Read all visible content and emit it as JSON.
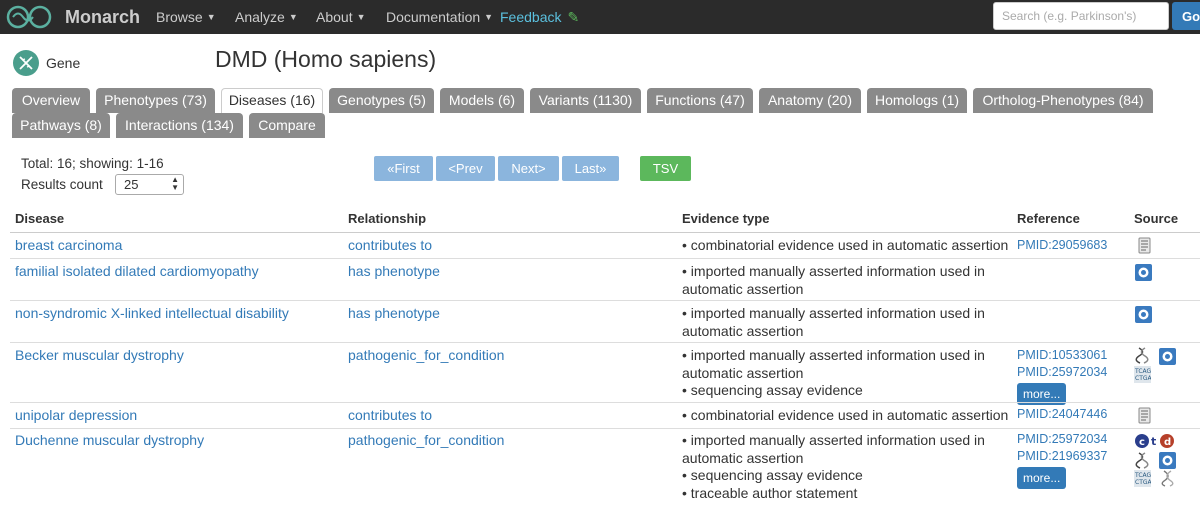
{
  "nav": {
    "brand": "Monarch",
    "items": [
      "Browse",
      "Analyze",
      "About",
      "Documentation"
    ],
    "feedback": "Feedback",
    "search_placeholder": "Search (e.g. Parkinson's)",
    "go": "Go"
  },
  "header": {
    "category": "Gene",
    "title": "DMD  (Homo sapiens)"
  },
  "tabs": [
    "Overview",
    "Phenotypes (73)",
    "Diseases (16)",
    "Genotypes (5)",
    "Models (6)",
    "Variants (1130)",
    "Functions (47)",
    "Anatomy (20)",
    "Homologs (1)",
    "Ortholog-Phenotypes (84)",
    "Pathways (8)",
    "Interactions (134)",
    "Compare"
  ],
  "active_tab": "Diseases (16)",
  "controls": {
    "total": "Total: 16; showing: 1-16",
    "results_count_label": "Results count",
    "results_count_value": "25",
    "pager": [
      "«First",
      "<Prev",
      "Next>",
      "Last»"
    ],
    "tsv": "TSV"
  },
  "table": {
    "headers": [
      "Disease",
      "Relationship",
      "Evidence type",
      "Reference",
      "Source"
    ],
    "more_label": "more...",
    "rows": [
      {
        "disease": "breast carcinoma",
        "relationship": "contributes to",
        "evidence": [
          "• combinatorial evidence used in automatic assertion"
        ],
        "references": [
          "PMID:29059683"
        ],
        "more": false,
        "sources": [
          "document-source-icon"
        ]
      },
      {
        "disease": "familial isolated dilated cardiomyopathy",
        "relationship": "has phenotype",
        "evidence": [
          "• imported manually asserted information used in automatic assertion"
        ],
        "references": [],
        "more": false,
        "sources": [
          "orphanet-source-icon"
        ]
      },
      {
        "disease": "non-syndromic X-linked intellectual disability",
        "relationship": "has phenotype",
        "evidence": [
          "• imported manually asserted information used in automatic assertion"
        ],
        "references": [],
        "more": false,
        "sources": [
          "orphanet-source-icon"
        ]
      },
      {
        "disease": "Becker muscular dystrophy",
        "relationship": "pathogenic_for_condition",
        "evidence": [
          "• imported manually asserted information used in automatic assertion",
          "• sequencing assay evidence"
        ],
        "references": [
          "PMID:10533061",
          "PMID:25972034"
        ],
        "more": true,
        "sources": [
          "clinvar-source-icon",
          "orphanet-source-icon",
          "tcag-source-icon"
        ]
      },
      {
        "disease": "unipolar depression",
        "relationship": "contributes to",
        "evidence": [
          "• combinatorial evidence used in automatic assertion"
        ],
        "references": [
          "PMID:24047446"
        ],
        "more": false,
        "sources": [
          "document-source-icon"
        ]
      },
      {
        "disease": "Duchenne muscular dystrophy",
        "relationship": "pathogenic_for_condition",
        "evidence": [
          "• imported manually asserted information used in automatic assertion",
          "• sequencing assay evidence",
          "• traceable author statement"
        ],
        "references": [
          "PMID:25972034",
          "PMID:21969337"
        ],
        "more": true,
        "sources": [
          "ctd-source-icon",
          "clinvar-source-icon",
          "orphanet-source-icon",
          "tcag-source-icon",
          "dna-source-icon"
        ]
      }
    ]
  },
  "colors": {
    "navbar": "#2b2b2b",
    "link": "#337ab7",
    "tab": "#8a8a8a",
    "pager": "#8bb5dd",
    "tsv": "#5cb85c",
    "feedback": "#5bc0de"
  }
}
